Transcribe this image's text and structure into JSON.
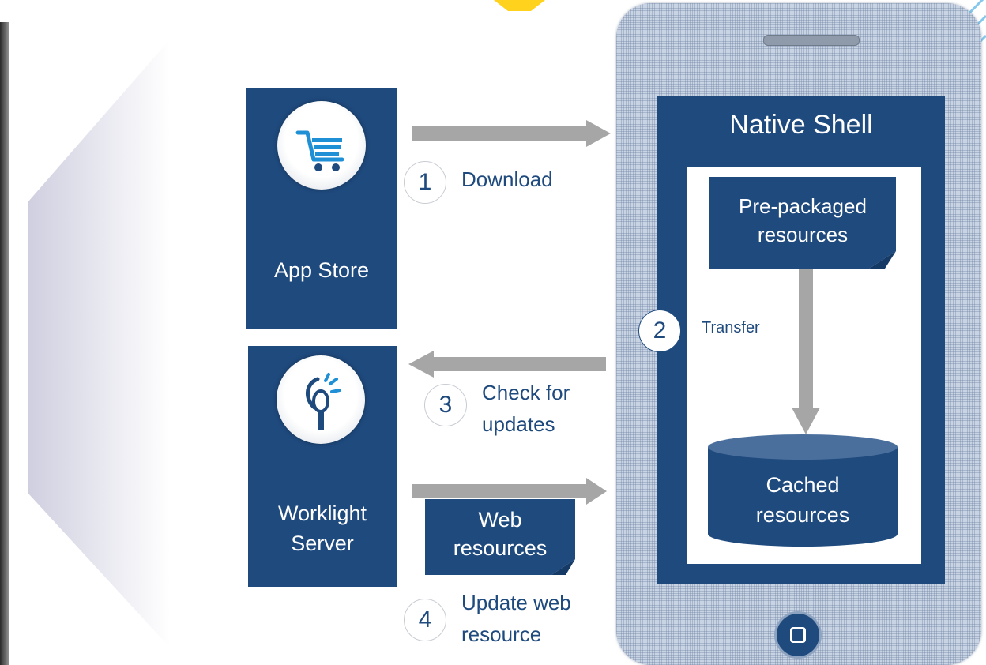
{
  "app_store": {
    "label": "App Store",
    "icon": "shopping-cart-icon"
  },
  "worklight_server": {
    "label_line1": "Worklight",
    "label_line2": "Server",
    "icon": "worklight-logo-icon"
  },
  "native_shell": {
    "title": "Native Shell"
  },
  "pre_packaged": {
    "line1": "Pre-packaged",
    "line2": "resources"
  },
  "cached": {
    "line1": "Cached",
    "line2": "resources"
  },
  "web_resources": {
    "line1": "Web",
    "line2": "resources"
  },
  "steps": [
    {
      "number": "1",
      "line1": "Download",
      "line2": ""
    },
    {
      "number": "2",
      "line1": "Transfer",
      "line2": ""
    },
    {
      "number": "3",
      "line1": "Check for",
      "line2": "updates"
    },
    {
      "number": "4",
      "line1": "Update web",
      "line2": "resource"
    }
  ],
  "colors": {
    "panel": "#1f4a7e",
    "arrow": "#a6a6a6",
    "phone": "#c8d3e4",
    "text": "#1f4a7e"
  }
}
